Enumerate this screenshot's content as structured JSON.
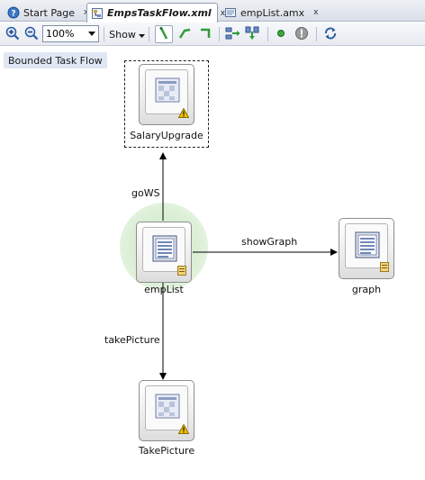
{
  "tabs": [
    {
      "label": "Start Page",
      "close": "x",
      "active": false
    },
    {
      "label": "EmpsTaskFlow.xml",
      "close": "x",
      "active": true
    },
    {
      "label": "empList.amx",
      "close": "x",
      "active": false
    }
  ],
  "toolbar": {
    "zoom_value": "100%",
    "show_label": "Show"
  },
  "canvas": {
    "badge": "Bounded Task Flow",
    "nodes": [
      {
        "name": "SalaryUpgrade",
        "kind": "task-flow-call",
        "warning": true
      },
      {
        "name": "empList",
        "kind": "view",
        "default_activity": true
      },
      {
        "name": "graph",
        "kind": "view"
      },
      {
        "name": "TakePicture",
        "kind": "task-flow-call",
        "warning": true
      }
    ],
    "edges": [
      {
        "label": "goWS",
        "from": "empList",
        "to": "SalaryUpgrade"
      },
      {
        "label": "showGraph",
        "from": "empList",
        "to": "graph"
      },
      {
        "label": "takePicture",
        "from": "empList",
        "to": "TakePicture"
      }
    ]
  },
  "colors": {
    "accent": "#3b78c4",
    "default_glow": "#cfe9c8",
    "warning": "#f2c200",
    "active_tab_border": "#8c9bb5"
  }
}
